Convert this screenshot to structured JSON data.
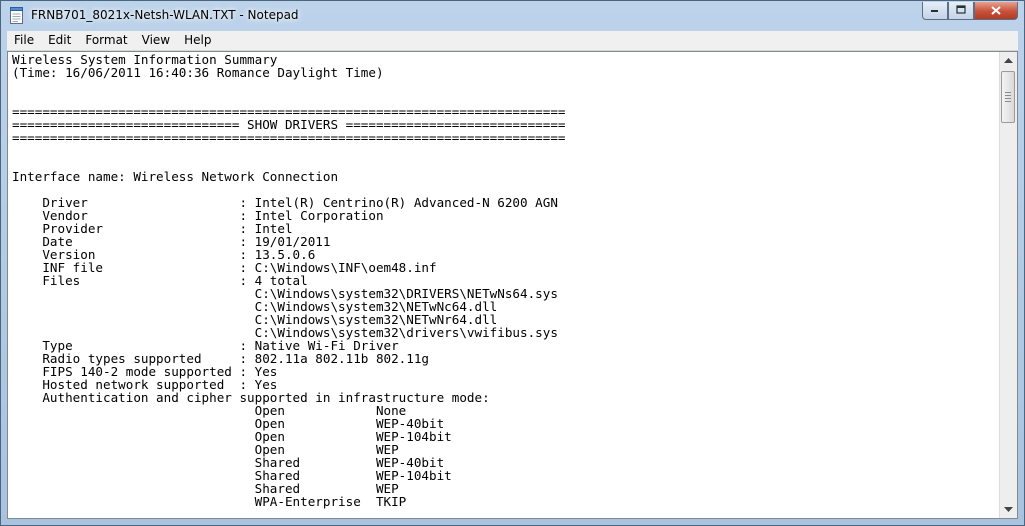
{
  "window": {
    "title": "FRNB701_8021x-Netsh-WLAN.TXT - Notepad",
    "icon": "notepad-icon"
  },
  "caption_buttons": {
    "minimize_icon": "minimize-icon",
    "maximize_icon": "maximize-icon",
    "close_icon": "close-icon"
  },
  "menu": {
    "items": [
      "File",
      "Edit",
      "Format",
      "View",
      "Help"
    ]
  },
  "document": {
    "lines": [
      "Wireless System Information Summary",
      "(Time: 16/06/2011 16:40:36 Romance Daylight Time)",
      "",
      "",
      "=========================================================================",
      "============================== SHOW DRIVERS =============================",
      "=========================================================================",
      "",
      "",
      "Interface name: Wireless Network Connection",
      "",
      "    Driver                    : Intel(R) Centrino(R) Advanced-N 6200 AGN",
      "    Vendor                    : Intel Corporation",
      "    Provider                  : Intel",
      "    Date                      : 19/01/2011",
      "    Version                   : 13.5.0.6",
      "    INF file                  : C:\\Windows\\INF\\oem48.inf",
      "    Files                     : 4 total",
      "                                C:\\Windows\\system32\\DRIVERS\\NETwNs64.sys",
      "                                C:\\Windows\\system32\\NETwNc64.dll",
      "                                C:\\Windows\\system32\\NETwNr64.dll",
      "                                C:\\Windows\\system32\\drivers\\vwifibus.sys",
      "    Type                      : Native Wi-Fi Driver",
      "    Radio types supported     : 802.11a 802.11b 802.11g",
      "    FIPS 140-2 mode supported : Yes",
      "    Hosted network supported  : Yes",
      "    Authentication and cipher supported in infrastructure mode:",
      "                                Open            None",
      "                                Open            WEP-40bit",
      "                                Open            WEP-104bit",
      "                                Open            WEP",
      "                                Shared          WEP-40bit",
      "                                Shared          WEP-104bit",
      "                                Shared          WEP",
      "                                WPA-Enterprise  TKIP"
    ]
  },
  "scrollbar": {
    "up_icon": "scroll-up-arrow-icon",
    "down_icon": "scroll-down-arrow-icon"
  }
}
